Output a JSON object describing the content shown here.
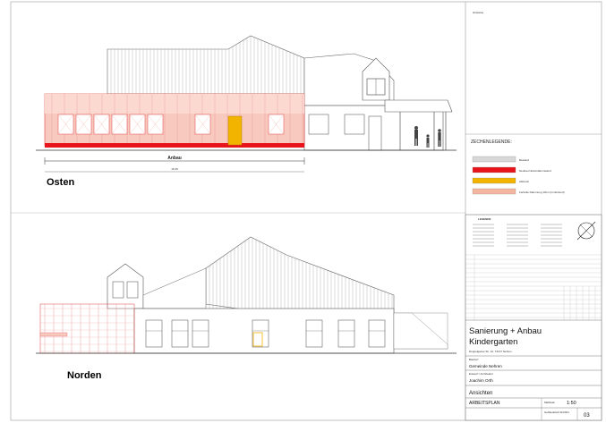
{
  "views": {
    "east_label": "Osten",
    "north_label": "Norden",
    "anbau_label": "Anbau",
    "east_dimension": "16.35"
  },
  "legend_right": {
    "hinweise": "Hinweise",
    "title": "ZECHENLEGENDE:",
    "items": [
      {
        "label": "Bestand",
        "color": "#d8d8d8"
      },
      {
        "label": "Neubau Nutzerdämmwand",
        "color": "#e8141c"
      },
      {
        "label": "Abbruch",
        "color": "#f3b400"
      },
      {
        "label": "Fertteile Dämmung 10cm (im Entwurf)",
        "color": "#f4b6a0"
      }
    ]
  },
  "titleblock": {
    "legende": "LEGENDE",
    "project_line1": "Sanierung + Anbau",
    "project_line2": "Kindergarten",
    "address": "Doppelgasse Str. 10, 72147 Nehren",
    "bauherr_label": "Bauherr",
    "bauherr": "Gemeinde Nehren",
    "architect_label": "Entwurf / Architektur",
    "architect": "Joachim Orth",
    "drawing_type": "Ansichten",
    "plan_type": "ARBEITSPLAN",
    "scale_label": "Maßstab",
    "scale": "1:50",
    "plan_no": "03",
    "revision_label": "Gebäudeteil 01/2021"
  },
  "colors": {
    "existing": "#d8d8d8",
    "new_wall": "#e8141c",
    "demolition": "#f3b400",
    "insulation": "#f4b6a0"
  }
}
